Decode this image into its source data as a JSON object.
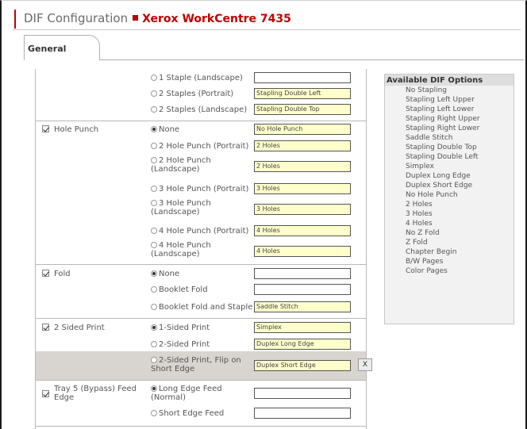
{
  "header": {
    "title": "DIF Configuration",
    "device": "Xerox WorkCentre 7435"
  },
  "tabs": [
    {
      "label": "General"
    }
  ],
  "staple": {
    "options": [
      {
        "label": "1 Staple (Landscape)",
        "value": ""
      },
      {
        "label": "2 Staples (Portrait)",
        "value": "Stapling Double Left"
      },
      {
        "label": "2 Staples (Landscape)",
        "value": "Stapling Double Top"
      }
    ]
  },
  "hole_punch": {
    "label": "Hole Punch",
    "checked": true,
    "options": [
      {
        "label": "None",
        "value": "No Hole Punch",
        "selected": true
      },
      {
        "label": "2 Hole Punch (Portrait)",
        "value": "2 Holes"
      },
      {
        "label": "2 Hole Punch (Landscape)",
        "value": "2 Holes"
      },
      {
        "label": "3 Hole Punch (Portrait)",
        "value": "3 Holes"
      },
      {
        "label": "3 Hole Punch (Landscape)",
        "value": "3 Holes"
      },
      {
        "label": "4 Hole Punch (Portrait)",
        "value": "4 Holes"
      },
      {
        "label": "4 Hole Punch (Landscape)",
        "value": "4 Holes"
      }
    ]
  },
  "fold": {
    "label": "Fold",
    "checked": true,
    "options": [
      {
        "label": "None",
        "value": "",
        "selected": true
      },
      {
        "label": "Booklet Fold",
        "value": ""
      },
      {
        "label": "Booklet Fold and Staple",
        "value": "Saddle Stitch"
      }
    ]
  },
  "sided": {
    "label": "2 Sided Print",
    "checked": true,
    "options": [
      {
        "label": "1-Sided Print",
        "value": "Simplex",
        "selected": true
      },
      {
        "label": "2-Sided Print",
        "value": "Duplex Long Edge"
      },
      {
        "label": "2-Sided Print, Flip on Short Edge",
        "value": "Duplex Short Edge"
      }
    ],
    "clear_label": "X"
  },
  "tray": {
    "label": "Tray 5 (Bypass) Feed Edge",
    "checked": true,
    "options": [
      {
        "label": "Long Edge Feed (Normal)",
        "value": "",
        "selected": true
      },
      {
        "label": "Short Edge Feed",
        "value": ""
      }
    ]
  },
  "available": {
    "title": "Available DIF Options",
    "items": [
      "No Stapling",
      "Stapling Left Upper",
      "Stapling Left Lower",
      "Stapling Right Upper",
      "Stapling Right Lower",
      "Saddle Stitch",
      "Stapling Double Top",
      "Stapling Double Left",
      "Simplex",
      "Duplex Long Edge",
      "Duplex Short Edge",
      "No Hole Punch",
      "2 Holes",
      "3 Holes",
      "4 Holes",
      "No Z Fold",
      "Z Fold",
      "Chapter Begin",
      "B/W Pages",
      "Color Pages"
    ]
  },
  "colors": {
    "accent": "#c00000",
    "field_filled": "#ffffcc",
    "highlight_row": "#d8d5d0"
  }
}
